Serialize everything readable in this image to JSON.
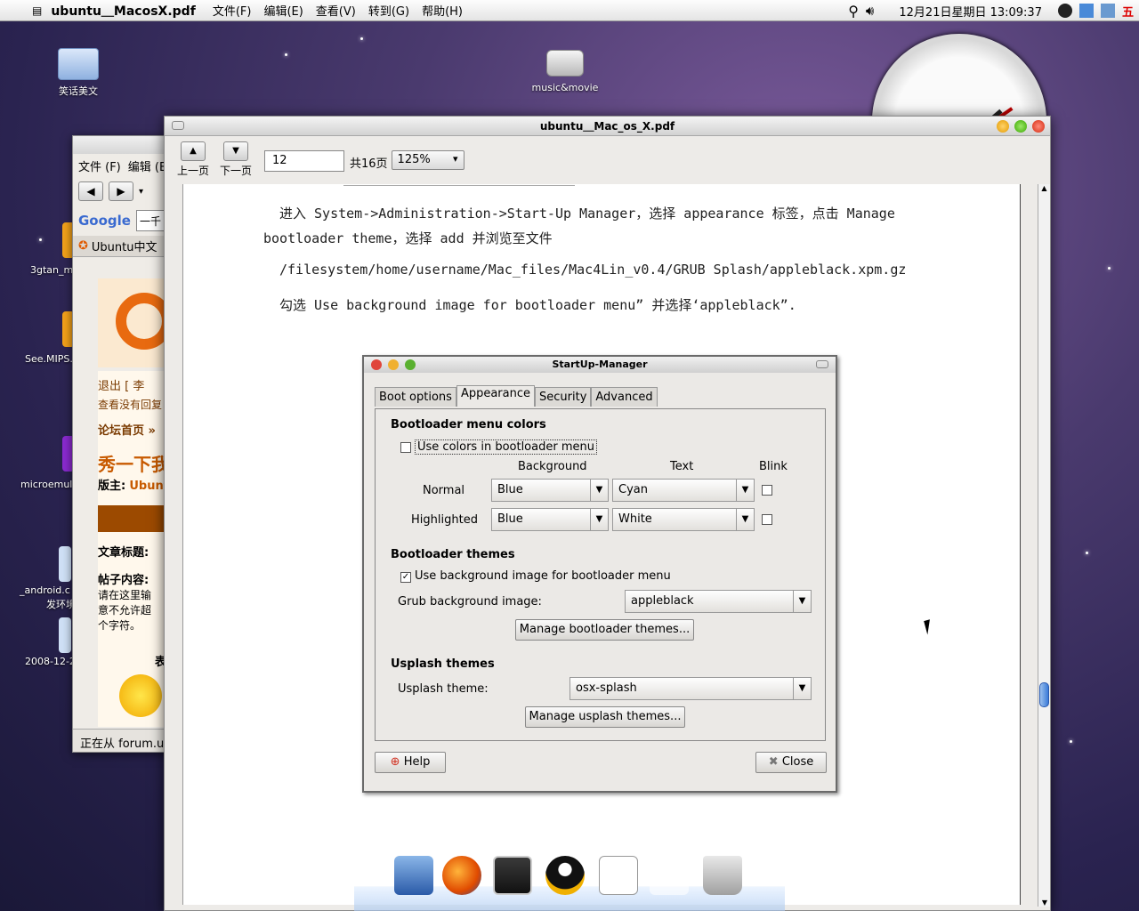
{
  "menubar": {
    "app_title": "ubuntu＿MacosX.pdf",
    "menus": [
      "文件(F)",
      "编辑(E)",
      "查看(V)",
      "转到(G)",
      "帮助(H)"
    ],
    "datetime": "12月21日星期日 13:09:37"
  },
  "desktop": {
    "icons": [
      {
        "label": "笑话美文"
      },
      {
        "label": "music&movie"
      }
    ],
    "side_labels": [
      "3gtan_m",
      "See.MIPS.",
      "microemul",
      "_android.c",
      "发环境",
      "2008-12-2"
    ]
  },
  "browser": {
    "menu": [
      "文件 (F)",
      "编辑 (E"
    ],
    "search_text": "一千",
    "tab_title": "Ubuntu中文",
    "links": [
      "退出 [ 李",
      "查看没有回复"
    ],
    "breadcrumb": "论坛首页 »",
    "heading": "秀一下我",
    "moderator_label": "版主:",
    "moderator_name": "Ubunt",
    "field_title": "文章标题:",
    "field_content": "帖子内容:",
    "hint": "请在这里输入。注意不允许超过个字符。",
    "hint_l1": "请在这里输",
    "hint_l2": "意不允许超",
    "hint_l3": "个字符。",
    "biao": "表",
    "status": "正在从 forum.u"
  },
  "pdf": {
    "window_title": "ubuntu＿Mac_os_X.pdf",
    "prev_label": "上一页",
    "next_label": "下一页",
    "page_number": "12",
    "page_total": "共16页",
    "zoom": "125%",
    "lines": {
      "l1": "进入 System->Administration->Start-Up Manager，选择 appearance 标签，点击 Manage",
      "l2": "bootloader theme，选择 add 并浏览至文件",
      "l3": "/filesystem/home/username/Mac_files/Mac4Lin_v0.4/GRUB Splash/appleblack.xpm.gz",
      "l4": "勾选 Use background image for bootloader menu”  并选择‘appleblack”."
    }
  },
  "startup_manager": {
    "title": "StartUp-Manager",
    "tabs": [
      "Boot options",
      "Appearance",
      "Security",
      "Advanced"
    ],
    "active_tab": "Appearance",
    "section_colors": "Bootloader menu colors",
    "use_colors_label": "Use colors in bootloader menu",
    "use_colors_checked": false,
    "col_background": "Background",
    "col_text": "Text",
    "col_blink": "Blink",
    "row_normal": "Normal",
    "row_highlighted": "Highlighted",
    "normal_bg": "Blue",
    "normal_text": "Cyan",
    "highlight_bg": "Blue",
    "highlight_text": "White",
    "section_themes": "Bootloader themes",
    "use_bg_image_label": "Use background image for bootloader menu",
    "use_bg_image_checked": true,
    "grub_bg_label": "Grub background image:",
    "grub_bg_value": "appleblack",
    "manage_bootloader_btn": "Manage bootloader themes...",
    "section_usplash": "Usplash themes",
    "usplash_label": "Usplash theme:",
    "usplash_value": "osx-splash",
    "manage_usplash_btn": "Manage usplash themes...",
    "help_btn": "Help",
    "close_btn": "Close"
  }
}
